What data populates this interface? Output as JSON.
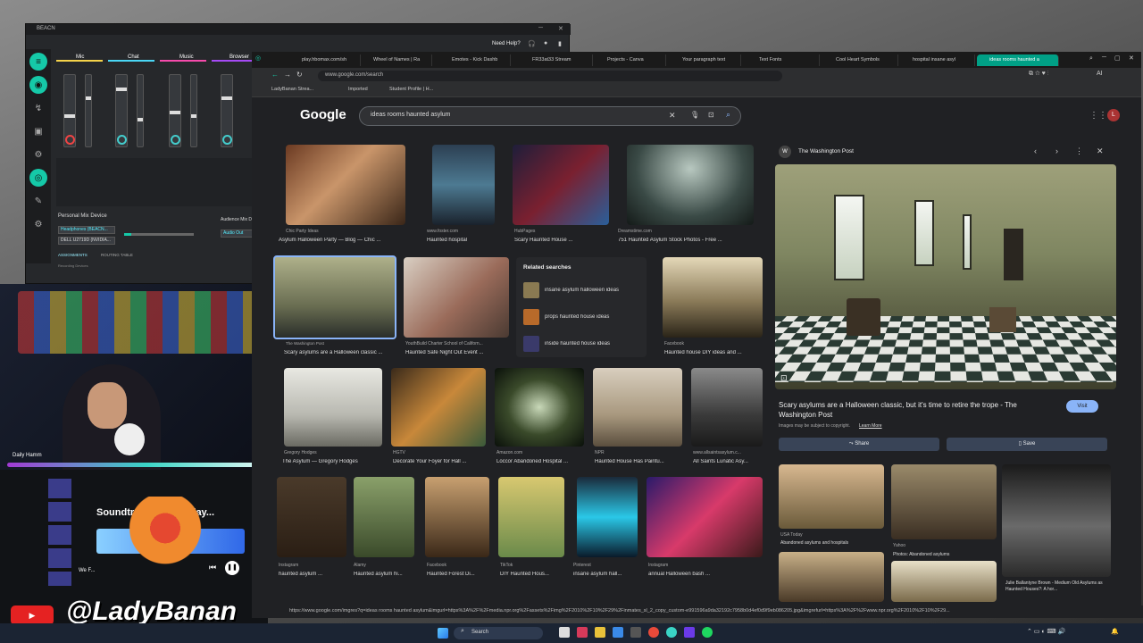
{
  "mixer": {
    "title": "BEACN",
    "help": "Need Help?",
    "channels": [
      "Mic",
      "Chat",
      "Music",
      "Browser"
    ],
    "device_section": "Personal Mix Device",
    "device_value": "Headphones (BEACN...",
    "device_value2": "DELL U2719D (NVIDIA...",
    "audience_label": "Audience Mix Device",
    "audience_value": "Audio Out",
    "recording_label": "Recording Devices",
    "tabs": [
      "ASSIGNMENTS",
      "ROUTING TABLE"
    ]
  },
  "browser": {
    "tabs": [
      "play.hbomax.com/sh",
      "Wheel of Names | Ra",
      "Emotes - Kick Dashb",
      "FR33at33 Stream",
      "Projects - Canva",
      "Your paragraph text",
      "Text Fonts",
      "Cool Heart Symbols",
      "hospital insane asyl",
      "ideas rooms haunted a"
    ],
    "url": "www.google.com/search",
    "bookmarks": [
      "LadyBanan Strea...",
      "Imported",
      "Student Profile | H..."
    ],
    "search_query": "ideas rooms haunted asylum",
    "results_row1": [
      {
        "src": "Chic Party Ideas",
        "title": "Asylum Halloween Party — Blog — Chic ..."
      },
      {
        "src": "www.foster.com",
        "title": "Haunted hospital"
      },
      {
        "src": "HubPages",
        "title": "Scary Haunted House ..."
      },
      {
        "src": "Dreamstime.com",
        "title": "751 Haunted Asylum Stock Photos - Free ..."
      }
    ],
    "results_row2": [
      {
        "src": "The Washington Post",
        "title": "Scary asylums are a Halloween classic ..."
      },
      {
        "src": "YouthBuild Charter School of Californ...",
        "title": "Haunted Safe Night Out Event ..."
      },
      {
        "src": "Facebook",
        "title": "Haunted house DIY ideas and ..."
      }
    ],
    "related": {
      "title": "Related searches",
      "items": [
        "insane asylum halloween ideas",
        "props haunted house ideas",
        "inside haunted house ideas"
      ]
    },
    "results_row3": [
      {
        "src": "Gregory Hodges",
        "title": "The Asylum — Gregory Hodges"
      },
      {
        "src": "HGTV",
        "title": "Decorate Your Foyer for Hall ..."
      },
      {
        "src": "Amazon.com",
        "title": "Loccor Abandoned Hospital ..."
      },
      {
        "src": "NPR",
        "title": "Haunted House Has Paintu..."
      },
      {
        "src": "www.allsaintsasylum.c...",
        "title": "All Saints Lunatic Asy..."
      }
    ],
    "results_row4": [
      {
        "src": "Instagram",
        "title": "haunted asylum ..."
      },
      {
        "src": "Alamy",
        "title": "Haunted asylum hi..."
      },
      {
        "src": "Facebook",
        "title": "Haunted Forest Di..."
      },
      {
        "src": "TikTok",
        "title": "DIY Haunted Hous..."
      },
      {
        "src": "Pinterest",
        "title": "insane asylum hall..."
      },
      {
        "src": "Instagram",
        "title": "annual Halloween bash ..."
      }
    ],
    "preview": {
      "source": "The Washington Post",
      "title": "Scary asylums are a Halloween classic, but it's time to retire the trope - The Washington Post",
      "visit": "Visit",
      "notice": "Images may be subject to copyright.",
      "learn_more": "Learn More",
      "share": "Share",
      "save": "Save",
      "related": [
        {
          "src": "USA Today",
          "title": "Abandoned asylums and hospitals"
        },
        {
          "src": "Yahoo",
          "title": "Photos: Abandoned asylums"
        },
        {
          "src": "",
          "title": "Julie Ballantyne Brown - Medium Old Asylums as Haunted Houses?: A hor..."
        }
      ]
    },
    "status_url": "https://www.google.com/imgres?q=ideas rooms haunted asylum&imgurl=https%3A%2F%2Fmedia.npr.org%2Fassets%2Fimg%2F2010%2F10%2F29%2Finmates_sl_2_copy_custom-e991596a9da32192c7958b0d4ef0d9f9eb086205.jpg&imgrefurl=https%3A%2F%2Fwww.npr.org%2F2010%2F10%2F29..."
  },
  "stream": {
    "name": "Daily Hamm",
    "watermark": "@LadyBanan",
    "spotify_title": "Soundtrack Your Friday...",
    "now_playing": "We F..."
  },
  "taskbar": {
    "search": "Search"
  }
}
